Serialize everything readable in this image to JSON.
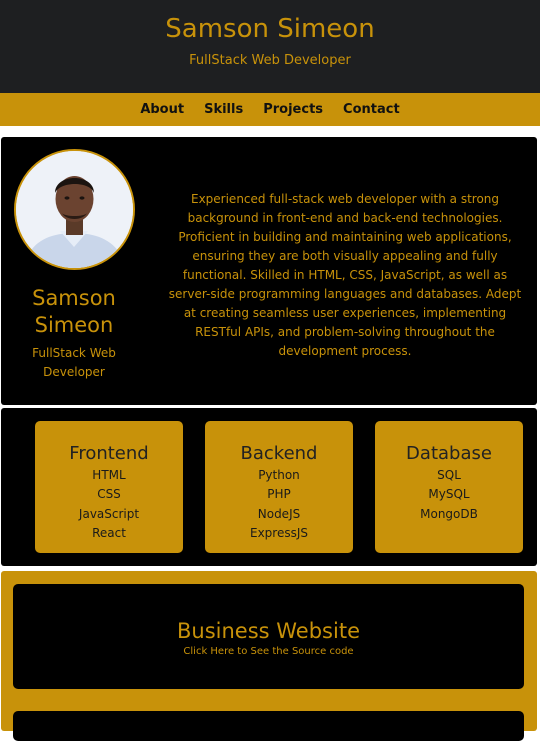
{
  "header": {
    "name": "Samson Simeon",
    "role": "FullStack Web Developer"
  },
  "nav": {
    "items": [
      "About",
      "Skills",
      "Projects",
      "Contact"
    ]
  },
  "about": {
    "name_line1": "Samson",
    "name_line2": "Simeon",
    "role_line1": "FullStack Web",
    "role_line2": "Developer",
    "bio": "Experienced full-stack web developer with a strong background in front-end and back-end technologies. Proficient in building and maintaining web applications, ensuring they are both visually appealing and fully functional. Skilled in HTML, CSS, JavaScript, as well as server-side programming languages and databases. Adept at creating seamless user experiences, implementing RESTful APIs, and problem-solving throughout the development process."
  },
  "skills": [
    {
      "title": "Frontend",
      "items": [
        "HTML",
        "CSS",
        "JavaScript",
        "React"
      ]
    },
    {
      "title": "Backend",
      "items": [
        "Python",
        "PHP",
        "NodeJS",
        "ExpressJS"
      ]
    },
    {
      "title": "Database",
      "items": [
        "SQL",
        "MySQL",
        "MongoDB"
      ]
    }
  ],
  "projects": [
    {
      "title": "Business Website",
      "link_text": "Click Here to See the Source code"
    }
  ],
  "colors": {
    "accent": "#c8920a",
    "header_bg": "#1e1f21",
    "panel_bg": "#000000"
  }
}
